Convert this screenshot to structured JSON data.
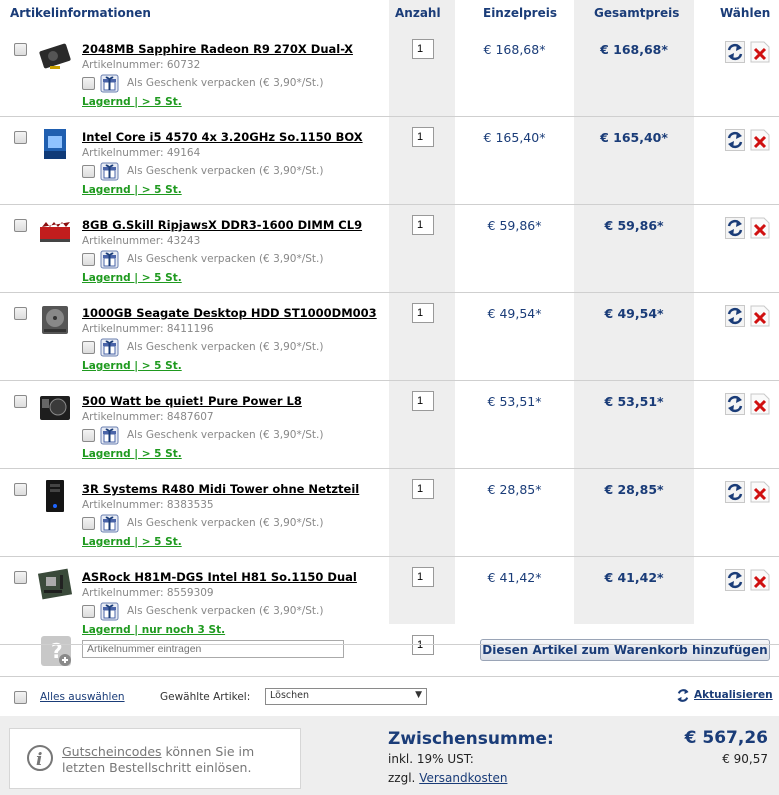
{
  "header": {
    "col_info": "Artikelinformationen",
    "col_qty": "Anzahl",
    "col_unit": "Einzelpreis",
    "col_total": "Gesamtpreis",
    "col_select": "Wählen"
  },
  "item_labels": {
    "gift_text": "Als Geschenk verpacken (€ 3,90*/St.)"
  },
  "items": [
    {
      "title": "2048MB Sapphire Radeon R9 270X Dual-X",
      "artnr": "Artikelnummer: 60732",
      "stock": "Lagernd | > 5 St.",
      "qty": "1",
      "unit": "€ 168,68*",
      "total": "€ 168,68*",
      "icon": "graphics-card-icon"
    },
    {
      "title": "Intel Core i5 4570 4x 3.20GHz So.1150 BOX",
      "artnr": "Artikelnummer: 49164",
      "stock": "Lagernd | > 5 St.",
      "qty": "1",
      "unit": "€ 165,40*",
      "total": "€ 165,40*",
      "icon": "cpu-box-icon"
    },
    {
      "title": "8GB G.Skill RipjawsX DDR3-1600 DIMM CL9",
      "artnr": "Artikelnummer: 43243",
      "stock": "Lagernd | > 5 St.",
      "qty": "1",
      "unit": "€ 59,86*",
      "total": "€ 59,86*",
      "icon": "ram-icon"
    },
    {
      "title": "1000GB Seagate Desktop HDD ST1000DM003",
      "artnr": "Artikelnummer: 8411196",
      "stock": "Lagernd | > 5 St.",
      "qty": "1",
      "unit": "€ 49,54*",
      "total": "€ 49,54*",
      "icon": "hdd-icon"
    },
    {
      "title": "500 Watt be quiet! Pure Power L8",
      "artnr": "Artikelnummer: 8487607",
      "stock": "Lagernd | > 5 St.",
      "qty": "1",
      "unit": "€ 53,51*",
      "total": "€ 53,51*",
      "icon": "psu-icon"
    },
    {
      "title": "3R Systems R480 Midi Tower ohne Netzteil",
      "artnr": "Artikelnummer: 8383535",
      "stock": "Lagernd | > 5 St.",
      "qty": "1",
      "unit": "€ 28,85*",
      "total": "€ 28,85*",
      "icon": "pc-case-icon"
    },
    {
      "title": "ASRock H81M-DGS Intel H81 So.1150 Dual",
      "artnr": "Artikelnummer: 8559309",
      "stock": "Lagernd | nur noch 3 St.",
      "qty": "1",
      "unit": "€ 41,42*",
      "total": "€ 41,42*",
      "icon": "motherboard-icon"
    }
  ],
  "add_item": {
    "placeholder": "Artikelnummer eintragen",
    "qty": "1",
    "button": "Diesen Artikel zum Warenkorb hinzufügen"
  },
  "actions": {
    "select_all": "Alles auswählen",
    "selected_label": "Gewählte Artikel:",
    "selected_option": "Löschen",
    "update": "Aktualisieren"
  },
  "voucher": {
    "link": "Gutscheincodes",
    "text1": " können Sie im",
    "text2": "letzten Bestellschritt einlösen."
  },
  "summary": {
    "subtotal_label": "Zwischensumme:",
    "subtotal_value": "€ 567,26",
    "vat_label": "inkl. 19% UST:",
    "vat_value": "€ 90,57",
    "shipping_prefix": "zzgl.",
    "shipping_link": "Versandkosten"
  },
  "colors": {
    "accent": "#1a3c78",
    "stock": "#1f9a1f",
    "delete": "#d01010"
  }
}
